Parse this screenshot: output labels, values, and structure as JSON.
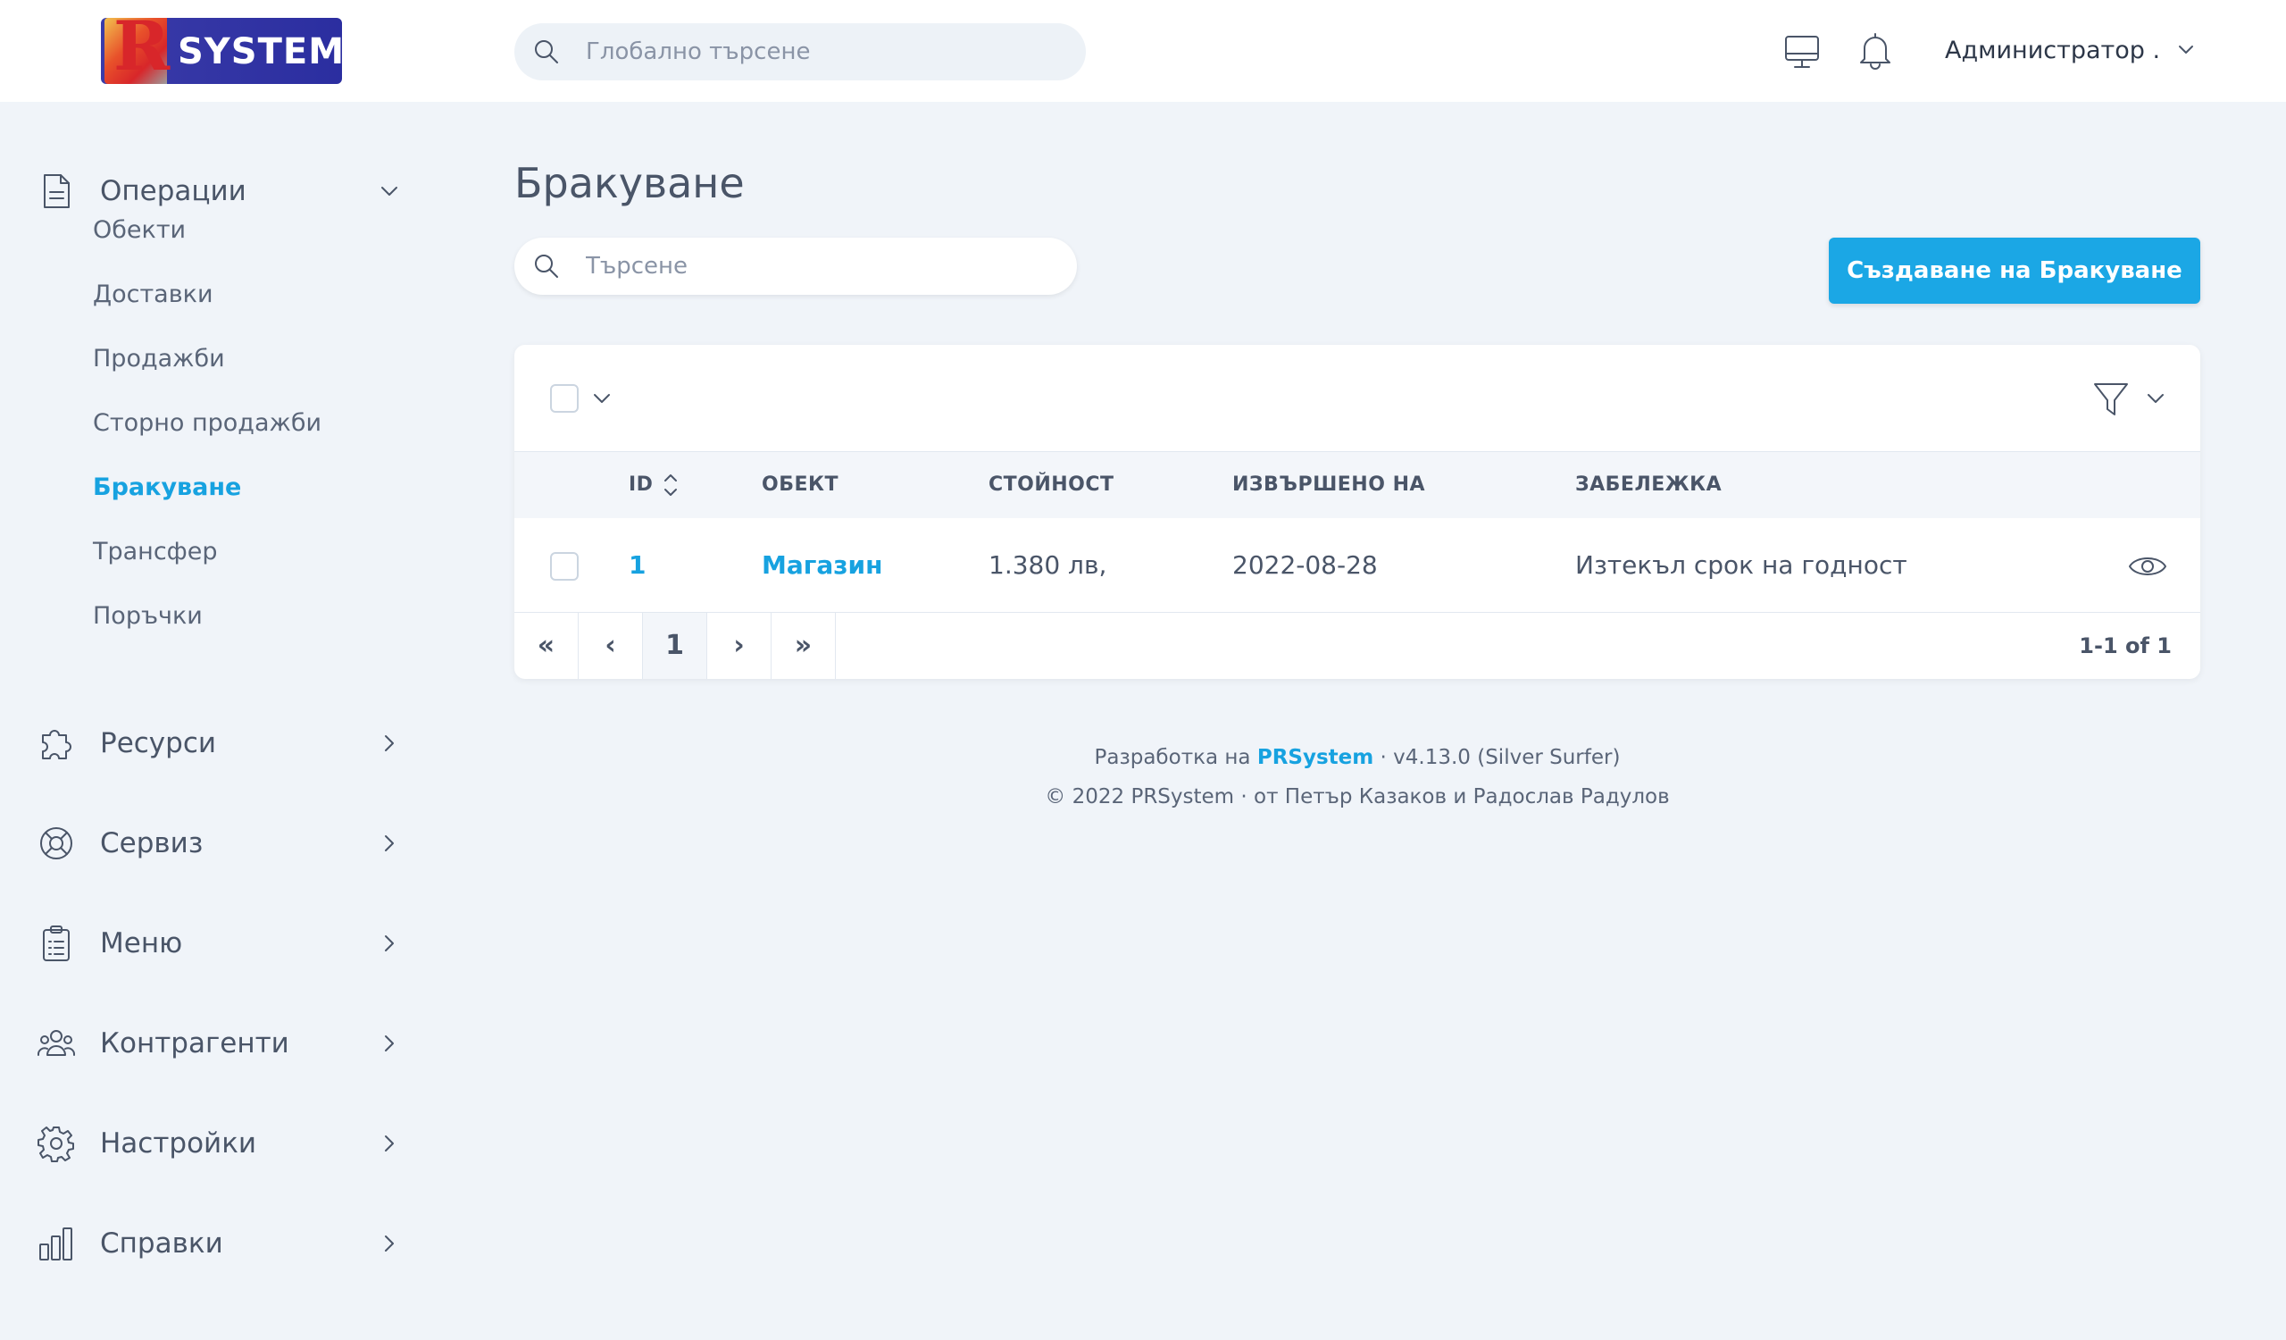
{
  "header": {
    "logo_text": "SYSTEM",
    "logo_letter": "R",
    "search_placeholder": "Глобално търсене",
    "user_name": "Администратор ."
  },
  "sidebar": {
    "groups": [
      {
        "label": "Операции",
        "icon": "document-icon",
        "expanded": true
      },
      {
        "label": "Ресурси",
        "icon": "puzzle-icon"
      },
      {
        "label": "Сервиз",
        "icon": "lifebuoy-icon"
      },
      {
        "label": "Меню",
        "icon": "clipboard-icon"
      },
      {
        "label": "Контрагенти",
        "icon": "users-icon"
      },
      {
        "label": "Настройки",
        "icon": "gear-icon"
      },
      {
        "label": "Справки",
        "icon": "bar-chart-icon"
      }
    ],
    "operations_items": [
      "Обекти",
      "Доставки",
      "Продажби",
      "Сторно продажби",
      "Бракуване",
      "Трансфер",
      "Поръчки"
    ],
    "active_item": "Бракуване"
  },
  "main": {
    "title": "Бракуване",
    "search_placeholder": "Търсене",
    "create_button": "Създаване на Бракуване",
    "table": {
      "columns": [
        "ID",
        "ОБЕКТ",
        "СТОЙНОСТ",
        "ИЗВЪРШЕНО НА",
        "ЗАБЕЛЕЖКА"
      ],
      "rows": [
        {
          "id": "1",
          "object": "Магазин",
          "value": "1.380 лв,",
          "date": "2022-08-28",
          "note": "Изтекъл срок на годност"
        }
      ]
    },
    "pagination": {
      "first": "«",
      "prev": "‹",
      "current": "1",
      "next": "›",
      "last": "»",
      "info": "1-1 of 1"
    }
  },
  "footer": {
    "line1_prefix": "Разработка на",
    "brand": "PRSystem",
    "line1_suffix": "· v4.13.0 (Silver Surfer)",
    "line2": "© 2022 PRSystem · от Петър Казаков и Радослав Радулов"
  },
  "colors": {
    "accent": "#1ba7e5",
    "background": "#f0f4f9",
    "text": "#4a5568"
  }
}
